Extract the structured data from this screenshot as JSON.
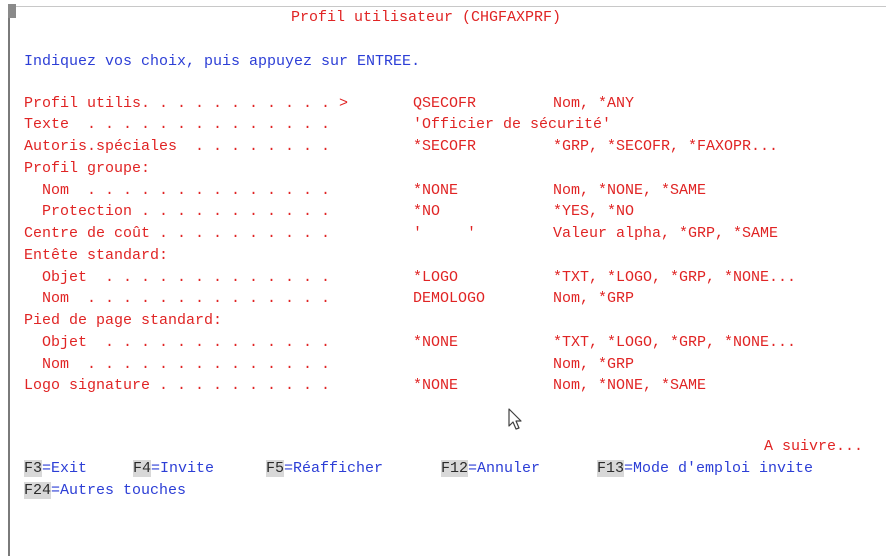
{
  "title": "Profil utilisateur (CHGFAXPRF)",
  "instruction": "Indiquez vos choix, puis appuyez sur ENTREE.",
  "fields": [
    {
      "label": "Profil utilis. . . . . . . . . . . > ",
      "value": "QSECOFR",
      "hint": "Nom, *ANY"
    },
    {
      "label": "Texte  . . . . . . . . . . . . . .",
      "value": "'Officier de sécurité'",
      "hint": ""
    },
    {
      "label": "Autoris.spéciales  . . . . . . . .",
      "value": "*SECOFR",
      "hint": "*GRP, *SECOFR, *FAXOPR..."
    },
    {
      "label": "Profil groupe:",
      "value": "",
      "hint": ""
    },
    {
      "label": "  Nom  . . . . . . . . . . . . . .",
      "value": "*NONE",
      "hint": "Nom, *NONE, *SAME"
    },
    {
      "label": "  Protection . . . . . . . . . . .",
      "value": "*NO",
      "hint": "*YES, *NO"
    },
    {
      "label": "Centre de coût . . . . . . . . . .",
      "value": "'     '",
      "hint": "Valeur alpha, *GRP, *SAME"
    },
    {
      "label": "Entête standard:",
      "value": "",
      "hint": ""
    },
    {
      "label": "  Objet  . . . . . . . . . . . . .",
      "value": "*LOGO",
      "hint": "*TXT, *LOGO, *GRP, *NONE..."
    },
    {
      "label": "  Nom  . . . . . . . . . . . . . .",
      "value": "DEMOLOGO",
      "hint": "Nom, *GRP"
    },
    {
      "label": "Pied de page standard:",
      "value": "",
      "hint": ""
    },
    {
      "label": "  Objet  . . . . . . . . . . . . .",
      "value": "*NONE",
      "hint": "*TXT, *LOGO, *GRP, *NONE..."
    },
    {
      "label": "  Nom  . . . . . . . . . . . . . .",
      "value": "",
      "hint": "Nom, *GRP"
    },
    {
      "label": "Logo signature . . . . . . . . . .",
      "value": "*NONE",
      "hint": "Nom, *NONE, *SAME"
    }
  ],
  "more": "A suivre...",
  "fkeys": [
    {
      "key": "F3",
      "desc": "=Exit"
    },
    {
      "key": "F4",
      "desc": "=Invite"
    },
    {
      "key": "F5",
      "desc": "=Réafficher"
    },
    {
      "key": "F12",
      "desc": "=Annuler"
    },
    {
      "key": "F13",
      "desc": "=Mode d'emploi invite"
    },
    {
      "key": "F24",
      "desc": "=Autres touches"
    }
  ],
  "colors": {
    "label": "#e02424",
    "function_key_desc": "#2c3ed6",
    "key_bg": "#d8d8d8"
  },
  "cursor_icon": "mouse-pointer-icon"
}
